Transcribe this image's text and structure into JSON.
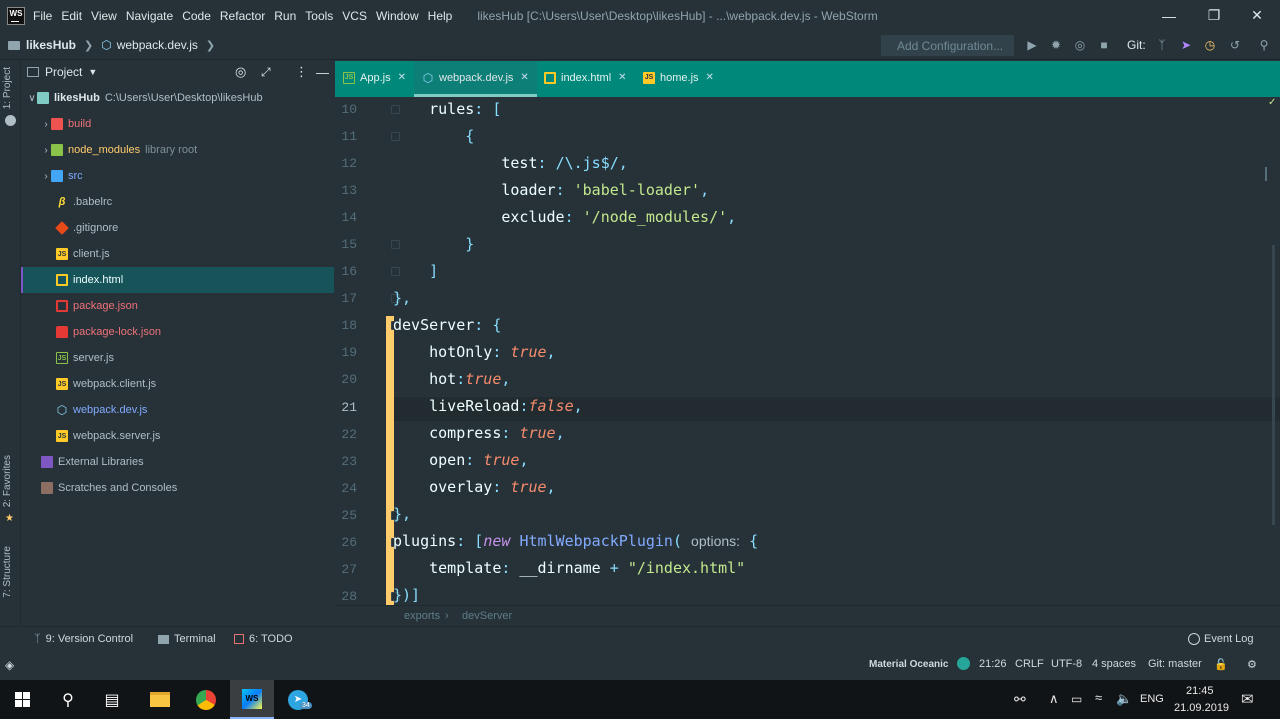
{
  "window": {
    "menu": [
      "File",
      "Edit",
      "View",
      "Navigate",
      "Code",
      "Refactor",
      "Run",
      "Tools",
      "VCS",
      "Window",
      "Help"
    ],
    "title": "likesHub [C:\\Users\\User\\Desktop\\likesHub] - ...\\webpack.dev.js - WebStorm",
    "logo_text": "WS"
  },
  "nav": {
    "project": "likesHub",
    "file": "webpack.dev.js",
    "add_config": "Add Configuration...",
    "git_label": "Git:"
  },
  "left_strip": {
    "project_tab": "1: Project",
    "favorites_tab": "2: Favorites",
    "structure_tab": "7: Structure"
  },
  "project_panel": {
    "title": "Project",
    "root": {
      "name": "likesHub",
      "path": "C:\\Users\\User\\Desktop\\likesHub"
    },
    "items": [
      {
        "name": "build",
        "icon": "folder-red-icon",
        "hint": ""
      },
      {
        "name": "node_modules",
        "icon": "folder-green-icon",
        "hint": "library root"
      },
      {
        "name": "src",
        "icon": "folder-blue-icon",
        "hint": ""
      },
      {
        "name": ".babelrc",
        "icon": "babel-icon",
        "hint": ""
      },
      {
        "name": ".gitignore",
        "icon": "git-icon",
        "hint": ""
      },
      {
        "name": "client.js",
        "icon": "js-icon",
        "hint": ""
      },
      {
        "name": "index.html",
        "icon": "html-icon",
        "hint": ""
      },
      {
        "name": "package.json",
        "icon": "npm-icon",
        "hint": ""
      },
      {
        "name": "package-lock.json",
        "icon": "lock-icon",
        "hint": ""
      },
      {
        "name": "server.js",
        "icon": "node-icon",
        "hint": ""
      },
      {
        "name": "webpack.client.js",
        "icon": "js-icon",
        "hint": ""
      },
      {
        "name": "webpack.dev.js",
        "icon": "webpack-icon",
        "hint": ""
      },
      {
        "name": "webpack.server.js",
        "icon": "js-icon",
        "hint": ""
      }
    ],
    "external_libraries": "External Libraries",
    "scratches": "Scratches and Consoles"
  },
  "tabs": [
    {
      "label": "App.js",
      "icon": "node-icon"
    },
    {
      "label": "webpack.dev.js",
      "icon": "webpack-icon",
      "active": true
    },
    {
      "label": "index.html",
      "icon": "html-icon"
    },
    {
      "label": "home.js",
      "icon": "js-icon"
    }
  ],
  "editor": {
    "line_numbers": [
      "10",
      "11",
      "12",
      "13",
      "14",
      "15",
      "16",
      "17",
      "18",
      "19",
      "20",
      "21",
      "22",
      "23",
      "24",
      "25",
      "26",
      "27",
      "28"
    ]
  },
  "breadcrumbs": [
    "exports",
    "devServer"
  ],
  "tool_windows": {
    "version_control": "9: Version Control",
    "terminal": "Terminal",
    "todo": "6: TODO",
    "event_log": "Event Log"
  },
  "status": {
    "theme": "Material Oceanic",
    "position": "21:26",
    "line_sep": "CRLF",
    "encoding": "UTF-8",
    "indent": "4 spaces",
    "git": "Git: master"
  },
  "taskbar": {
    "lang": "ENG",
    "time": "21:45",
    "date": "21.09.2019",
    "telegram_badge": "34"
  },
  "colors": {
    "accent": "#00897b",
    "change_bar": "#ffcb6b",
    "selection": "#17545a"
  }
}
